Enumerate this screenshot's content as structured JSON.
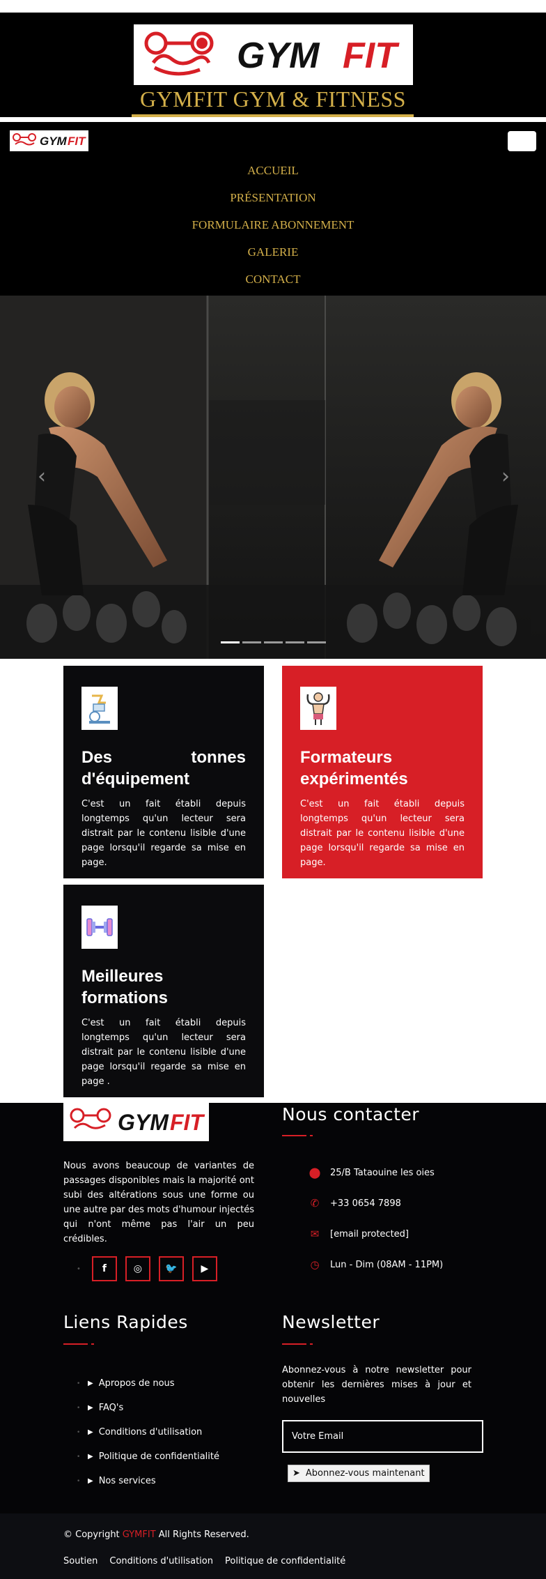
{
  "header": {
    "logo_text_black": "GYM",
    "logo_text_red": "FIT",
    "title": "GYMFIT GYM & FITNESS"
  },
  "nav": {
    "logo_text_black": "GYM",
    "logo_text_red": "FIT",
    "links": [
      {
        "label": "ACCUEIL"
      },
      {
        "label": "PRÉSENTATION"
      },
      {
        "label": "FORMULAIRE ABONNEMENT"
      },
      {
        "label": "GALERIE"
      },
      {
        "label": "CONTACT"
      }
    ]
  },
  "hero": {
    "prev_glyph": "‹",
    "next_glyph": "›",
    "slide_count": 5,
    "active_slide": 1
  },
  "features": [
    {
      "title": "Des tonnes d'équipement",
      "text": "C'est un fait établi depuis longtemps qu'un lecteur sera distrait par le contenu lisible d'une page lorsqu'il regarde sa mise en page.",
      "icon": "exercise-bike-icon"
    },
    {
      "title": "Formateurs expérimentés",
      "text": "C'est un fait établi depuis longtemps qu'un lecteur sera distrait par le contenu lisible d'une page lorsqu'il regarde sa mise en page.",
      "icon": "bodybuilder-icon"
    },
    {
      "title": "Meilleures formations",
      "text": "C'est un fait établi depuis longtemps qu'un lecteur sera distrait par le contenu lisible d'une page lorsqu'il regarde sa mise en page .",
      "icon": "dumbbell-icon"
    }
  ],
  "footer": {
    "logo_text_black": "GYM",
    "logo_text_red": "FIT",
    "about": "Nous avons beaucoup de variantes de passages disponibles mais la majorité ont subi des altérations sous une forme ou une autre par des mots d'humour injectés qui n'ont même pas l'air un peu crédibles.",
    "social": [
      {
        "glyph": "f",
        "icon": "facebook-icon"
      },
      {
        "glyph": "◎",
        "icon": "instagram-icon"
      },
      {
        "glyph": "🐦",
        "icon": "twitter-icon"
      },
      {
        "glyph": "▶",
        "icon": "youtube-icon"
      }
    ],
    "contact_heading": "Nous contacter",
    "contact": [
      {
        "glyph": "⬤",
        "icon": "map-pin-icon",
        "text": "25/B Tataouine les oies"
      },
      {
        "glyph": "✆",
        "icon": "phone-icon",
        "text": "+33 0654 7898"
      },
      {
        "glyph": "✉",
        "icon": "envelope-icon",
        "text": "[email protected]"
      },
      {
        "glyph": "◷",
        "icon": "clock-icon",
        "text": "Lun - Dim (08AM - 11PM)"
      }
    ],
    "links_heading": "Liens Rapides",
    "links": [
      {
        "label": "Apropos de nous"
      },
      {
        "label": "FAQ's"
      },
      {
        "label": "Conditions d'utilisation"
      },
      {
        "label": "Politique de confidentialité"
      },
      {
        "label": "Nos services"
      }
    ],
    "newsletter_heading": "Newsletter",
    "newsletter_text": "Abonnez-vous à notre newsletter pour obtenir les dernières mises à jour et nouvelles",
    "email_placeholder": "Votre Email",
    "subscribe_label": "Abonnez-vous maintenant"
  },
  "bottom": {
    "copyright_prefix": "© Copyright",
    "copyright_brand": "GYMFIT",
    "copyright_suffix": "All Rights Reserved.",
    "links": [
      {
        "label": "Soutien"
      },
      {
        "label": "Conditions d'utilisation"
      },
      {
        "label": "Politique de confidentialité"
      }
    ]
  },
  "colors": {
    "accent_red": "#d71f26",
    "gold": "#d4b04a",
    "dark": "#0b0b0d"
  }
}
